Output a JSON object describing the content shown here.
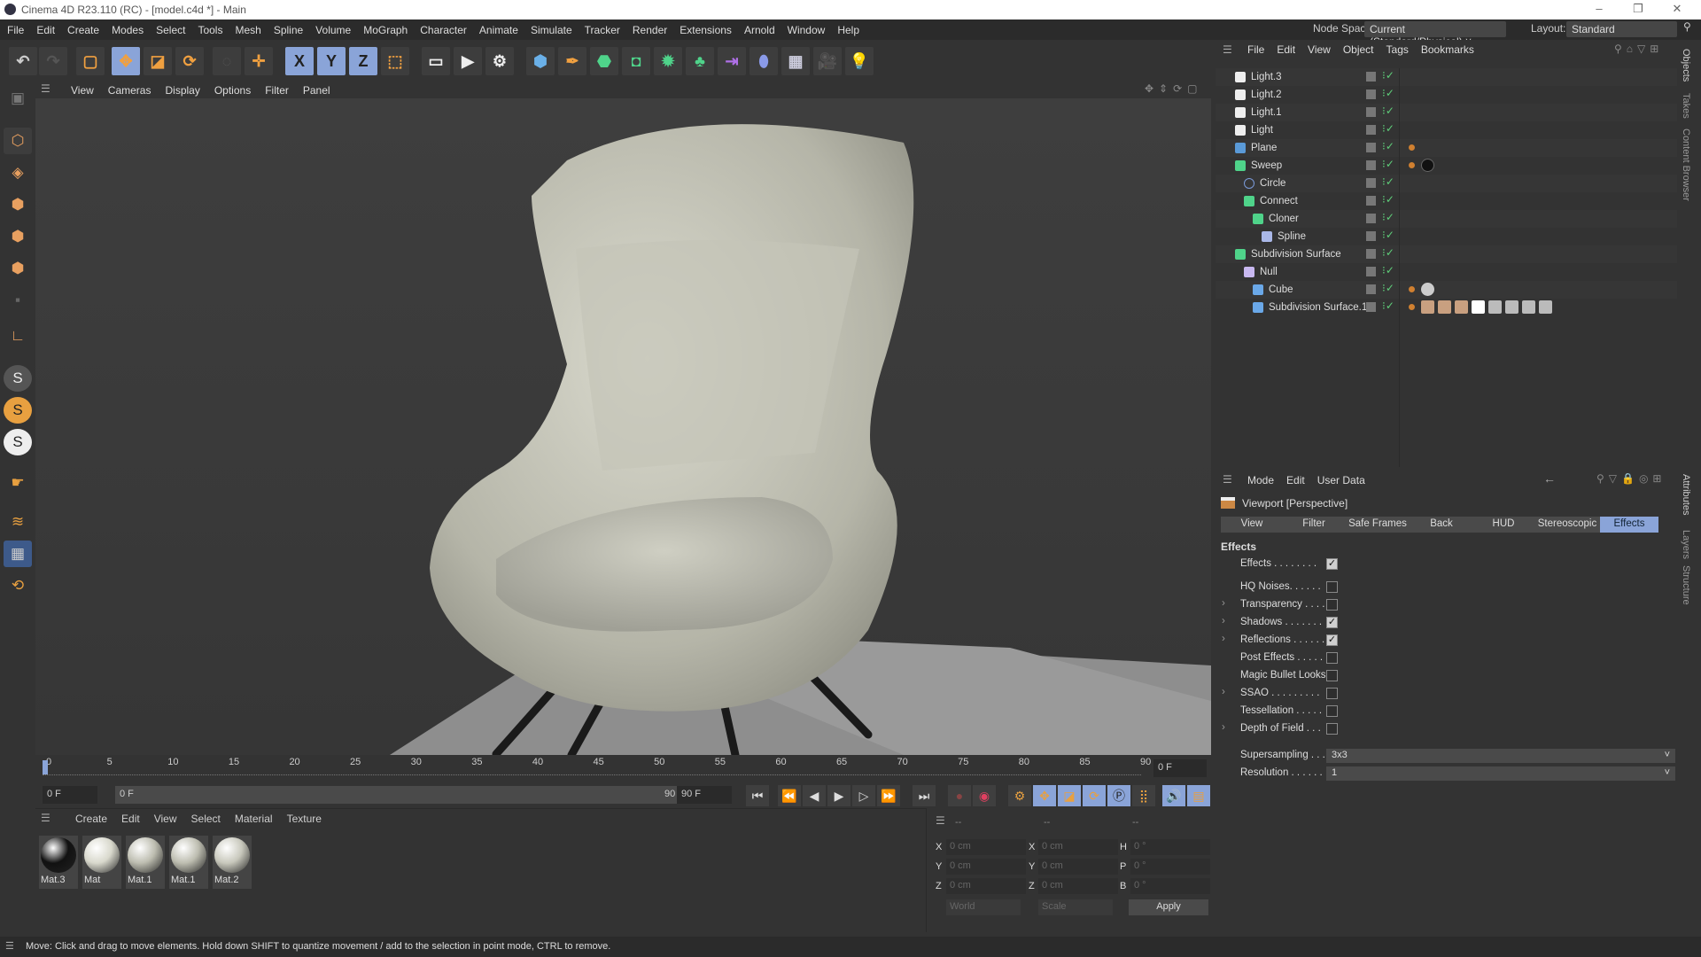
{
  "window": {
    "title": "Cinema 4D R23.110 (RC) - [model.c4d *] - Main",
    "min": "–",
    "max": "❐",
    "close": "✕"
  },
  "menubar": [
    "File",
    "Edit",
    "Create",
    "Modes",
    "Select",
    "Tools",
    "Mesh",
    "Spline",
    "Volume",
    "MoGraph",
    "Character",
    "Animate",
    "Simulate",
    "Tracker",
    "Render",
    "Extensions",
    "Arnold",
    "Window",
    "Help"
  ],
  "node_space": {
    "label": "Node Space:",
    "value": "Current (Standard/Physical)"
  },
  "layout": {
    "label": "Layout:",
    "value": "Standard"
  },
  "toolbar": {
    "x": "X",
    "y": "Y",
    "z": "Z"
  },
  "viewport_menu": [
    "View",
    "Cameras",
    "Display",
    "Options",
    "Filter",
    "Panel"
  ],
  "timeline": {
    "ticks": [
      "0",
      "5",
      "10",
      "15",
      "20",
      "25",
      "30",
      "35",
      "40",
      "45",
      "50",
      "55",
      "60",
      "65",
      "70",
      "75",
      "80",
      "85",
      "90"
    ],
    "current_frame": "0 F",
    "start": "0 F",
    "range_start": "0 F",
    "range_end": "90 F",
    "end": "90 F",
    "progress": 0
  },
  "material_menu": [
    "Create",
    "Edit",
    "View",
    "Select",
    "Material",
    "Texture"
  ],
  "materials": [
    {
      "name": "Mat.3",
      "color": "#111111"
    },
    {
      "name": "Mat",
      "color": "#d8d8cc"
    },
    {
      "name": "Mat.1",
      "color": "#bdbdb0"
    },
    {
      "name": "Mat.1",
      "color": "#bdbdb0"
    },
    {
      "name": "Mat.2",
      "color": "#c8c8bc"
    }
  ],
  "coords": {
    "headers": [
      "--",
      "--",
      "--"
    ],
    "pos": {
      "x": "0 cm",
      "y": "0 cm",
      "z": "0 cm"
    },
    "size": {
      "x": "0 cm",
      "y": "0 cm",
      "z": "0 cm"
    },
    "rot": {
      "h": "0 °",
      "p": "0 °",
      "b": "0 °"
    },
    "labels": [
      "X",
      "Y",
      "Z",
      "X",
      "Y",
      "Z",
      "H",
      "P",
      "B"
    ],
    "world": "World",
    "scale": "Scale",
    "apply": "Apply"
  },
  "status": "Move: Click and drag to move elements. Hold down SHIFT to quantize movement / add to the selection in point mode, CTRL to remove.",
  "objects_menu": [
    "File",
    "Edit",
    "View",
    "Object",
    "Tags",
    "Bookmarks"
  ],
  "objects": [
    {
      "name": "Light.3",
      "indent": 0,
      "icon": "light",
      "color": "#eeeeee"
    },
    {
      "name": "Light.2",
      "indent": 0,
      "icon": "light",
      "color": "#eeeeee"
    },
    {
      "name": "Light.1",
      "indent": 0,
      "icon": "light",
      "color": "#eeeeee"
    },
    {
      "name": "Light",
      "indent": 0,
      "icon": "light",
      "color": "#eeeeee"
    },
    {
      "name": "Plane",
      "indent": 0,
      "icon": "plane",
      "color": "#5a9ad8"
    },
    {
      "name": "Sweep",
      "indent": 0,
      "icon": "sweep",
      "color": "#4fd38a"
    },
    {
      "name": "Circle",
      "indent": 1,
      "icon": "circle",
      "color": "#7a9ad8"
    },
    {
      "name": "Connect",
      "indent": 1,
      "icon": "connect",
      "color": "#4fd38a"
    },
    {
      "name": "Cloner",
      "indent": 2,
      "icon": "cloner",
      "color": "#4fd38a"
    },
    {
      "name": "Spline",
      "indent": 3,
      "icon": "spline",
      "color": "#aab8e8"
    },
    {
      "name": "Subdivision Surface",
      "indent": 0,
      "icon": "subdivision",
      "color": "#4fd38a"
    },
    {
      "name": "Null",
      "indent": 1,
      "icon": "null",
      "color": "#c8b8f0"
    },
    {
      "name": "Cube",
      "indent": 2,
      "icon": "cube",
      "color": "#6aa8e8"
    },
    {
      "name": "Subdivision Surface.1",
      "indent": 2,
      "icon": "sculpt",
      "color": "#6aa8e8"
    }
  ],
  "side_tabs": {
    "objects": "Objects",
    "takes": "Takes",
    "content": "Content Browser",
    "attributes": "Attributes",
    "layers": "Layers",
    "structure": "Structure"
  },
  "attributes": {
    "menu": [
      "Mode",
      "Edit",
      "User Data"
    ],
    "title": "Viewport [Perspective]",
    "tabs": [
      "View",
      "Filter",
      "Safe Frames",
      "Back",
      "HUD",
      "Stereoscopic",
      "Effects"
    ],
    "active_tab": "Effects",
    "section": "Effects",
    "rows": [
      {
        "label": "Effects . . . . . . . .",
        "checked": true,
        "expand": false
      },
      {
        "label": "HQ Noises. . . . . .",
        "checked": false,
        "expand": false
      },
      {
        "label": "Transparency . . . .",
        "checked": false,
        "expand": true
      },
      {
        "label": "Shadows . . . . . . .",
        "checked": true,
        "expand": true
      },
      {
        "label": "Reflections . . . . . .",
        "checked": true,
        "expand": true
      },
      {
        "label": "Post Effects . . . . .",
        "checked": false,
        "expand": false
      },
      {
        "label": "Magic Bullet Looks",
        "checked": false,
        "expand": false
      },
      {
        "label": "SSAO . . . . . . . . .",
        "checked": false,
        "expand": true
      },
      {
        "label": "Tessellation . . . . .",
        "checked": false,
        "expand": false
      },
      {
        "label": "Depth of Field . . .",
        "checked": false,
        "expand": true
      }
    ],
    "supersampling": {
      "label": "Supersampling . . .",
      "value": "3x3"
    },
    "resolution": {
      "label": "Resolution . . . . . .",
      "value": "1"
    }
  },
  "colors": {
    "accent": "#8aa4d8",
    "panel": "#333333",
    "chair": "#c9c9bd"
  }
}
